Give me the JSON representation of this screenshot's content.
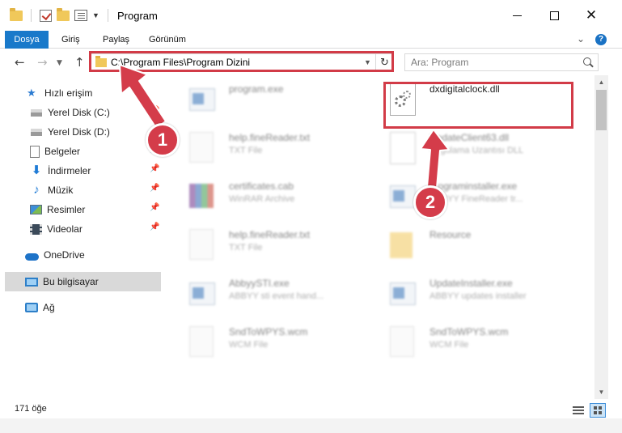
{
  "window": {
    "title": "Program"
  },
  "ribbon": {
    "tabs": [
      "Dosya",
      "Giriş",
      "Paylaş",
      "Görünüm"
    ]
  },
  "nav": {
    "address_path": "C:\\Program Files\\Program Dizini",
    "search_placeholder": "Ara: Program"
  },
  "sidebar": {
    "items": [
      {
        "label": "Hızlı erişim",
        "icon": "star-icon"
      },
      {
        "label": "Yerel Disk (C:)",
        "icon": "drive-icon"
      },
      {
        "label": "Yerel Disk (D:)",
        "icon": "drive-icon"
      },
      {
        "label": "Belgeler",
        "icon": "documents-icon"
      },
      {
        "label": "İndirmeler",
        "icon": "downloads-icon"
      },
      {
        "label": "Müzik",
        "icon": "music-icon"
      },
      {
        "label": "Resimler",
        "icon": "pictures-icon"
      },
      {
        "label": "Videolar",
        "icon": "videos-icon"
      },
      {
        "label": "OneDrive",
        "icon": "cloud-icon"
      },
      {
        "label": "Bu bilgisayar",
        "icon": "computer-icon"
      },
      {
        "label": "Ağ",
        "icon": "network-icon"
      }
    ],
    "pin_glyph": "📌"
  },
  "files": [
    {
      "name": "program.exe",
      "type": ""
    },
    {
      "name": "dxdigitalclock.dll",
      "type": ""
    },
    {
      "name": "help.fineReader.txt",
      "type": "TXT File"
    },
    {
      "name": "UpdateClient63.dll",
      "type": "Uygulama Uzantısı DLL"
    },
    {
      "name": "certificates.cab",
      "type": "WinRAR Archive"
    },
    {
      "name": "programinstaller.exe",
      "type": "ABBYY FineReader tr..."
    },
    {
      "name": "help.fineReader.txt",
      "type": "TXT File"
    },
    {
      "name": "Resource",
      "type": ""
    },
    {
      "name": "AbbyySTI.exe",
      "type": "ABBYY sti event hand..."
    },
    {
      "name": "UpdateInstaller.exe",
      "type": "ABBYY updates installer"
    },
    {
      "name": "SndToWPYS.wcm",
      "type": "WCM File"
    },
    {
      "name": "SndToWPYS.wcm",
      "type": "WCM File"
    }
  ],
  "status": {
    "item_count": "171 öğe"
  },
  "callouts": {
    "one": "1",
    "two": "2"
  },
  "colors": {
    "accent": "#1979ca",
    "callout": "#d43c4a"
  }
}
